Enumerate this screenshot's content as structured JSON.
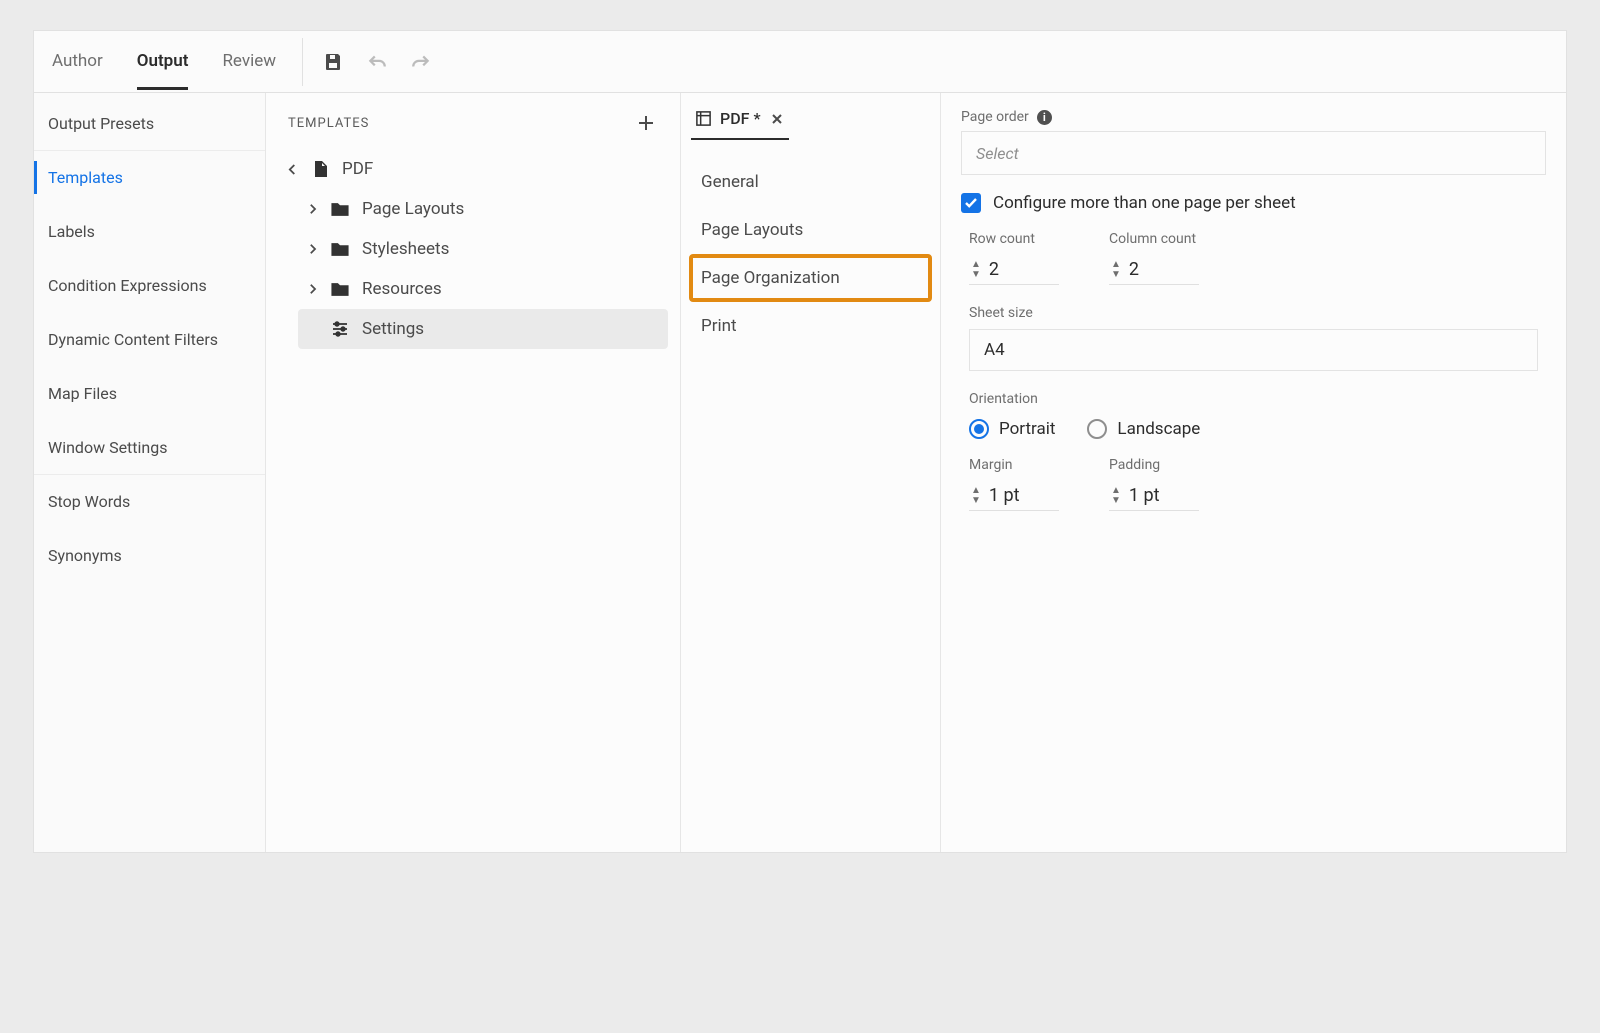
{
  "topbar": {
    "tabs": {
      "author": "Author",
      "output": "Output",
      "review": "Review"
    }
  },
  "sidebar": {
    "items": [
      "Output Presets",
      "Templates",
      "Labels",
      "Condition Expressions",
      "Dynamic Content Filters",
      "Map Files",
      "Window Settings",
      "Stop Words",
      "Synonyms"
    ]
  },
  "templates": {
    "title": "TEMPLATES",
    "root": "PDF",
    "children": [
      "Page Layouts",
      "Stylesheets",
      "Resources",
      "Settings"
    ]
  },
  "subpanel": {
    "tab_label": "PDF *",
    "items": [
      "General",
      "Page Layouts",
      "Page Organization",
      "Print"
    ]
  },
  "props": {
    "page_order_label": "Page order",
    "page_order_placeholder": "Select",
    "configure_label": "Configure more than one page per sheet",
    "row_count_label": "Row count",
    "row_count_value": "2",
    "column_count_label": "Column count",
    "column_count_value": "2",
    "sheet_size_label": "Sheet size",
    "sheet_size_value": "A4",
    "orientation_label": "Orientation",
    "orientation_portrait": "Portrait",
    "orientation_landscape": "Landscape",
    "margin_label": "Margin",
    "margin_value": "1 pt",
    "padding_label": "Padding",
    "padding_value": "1 pt"
  }
}
